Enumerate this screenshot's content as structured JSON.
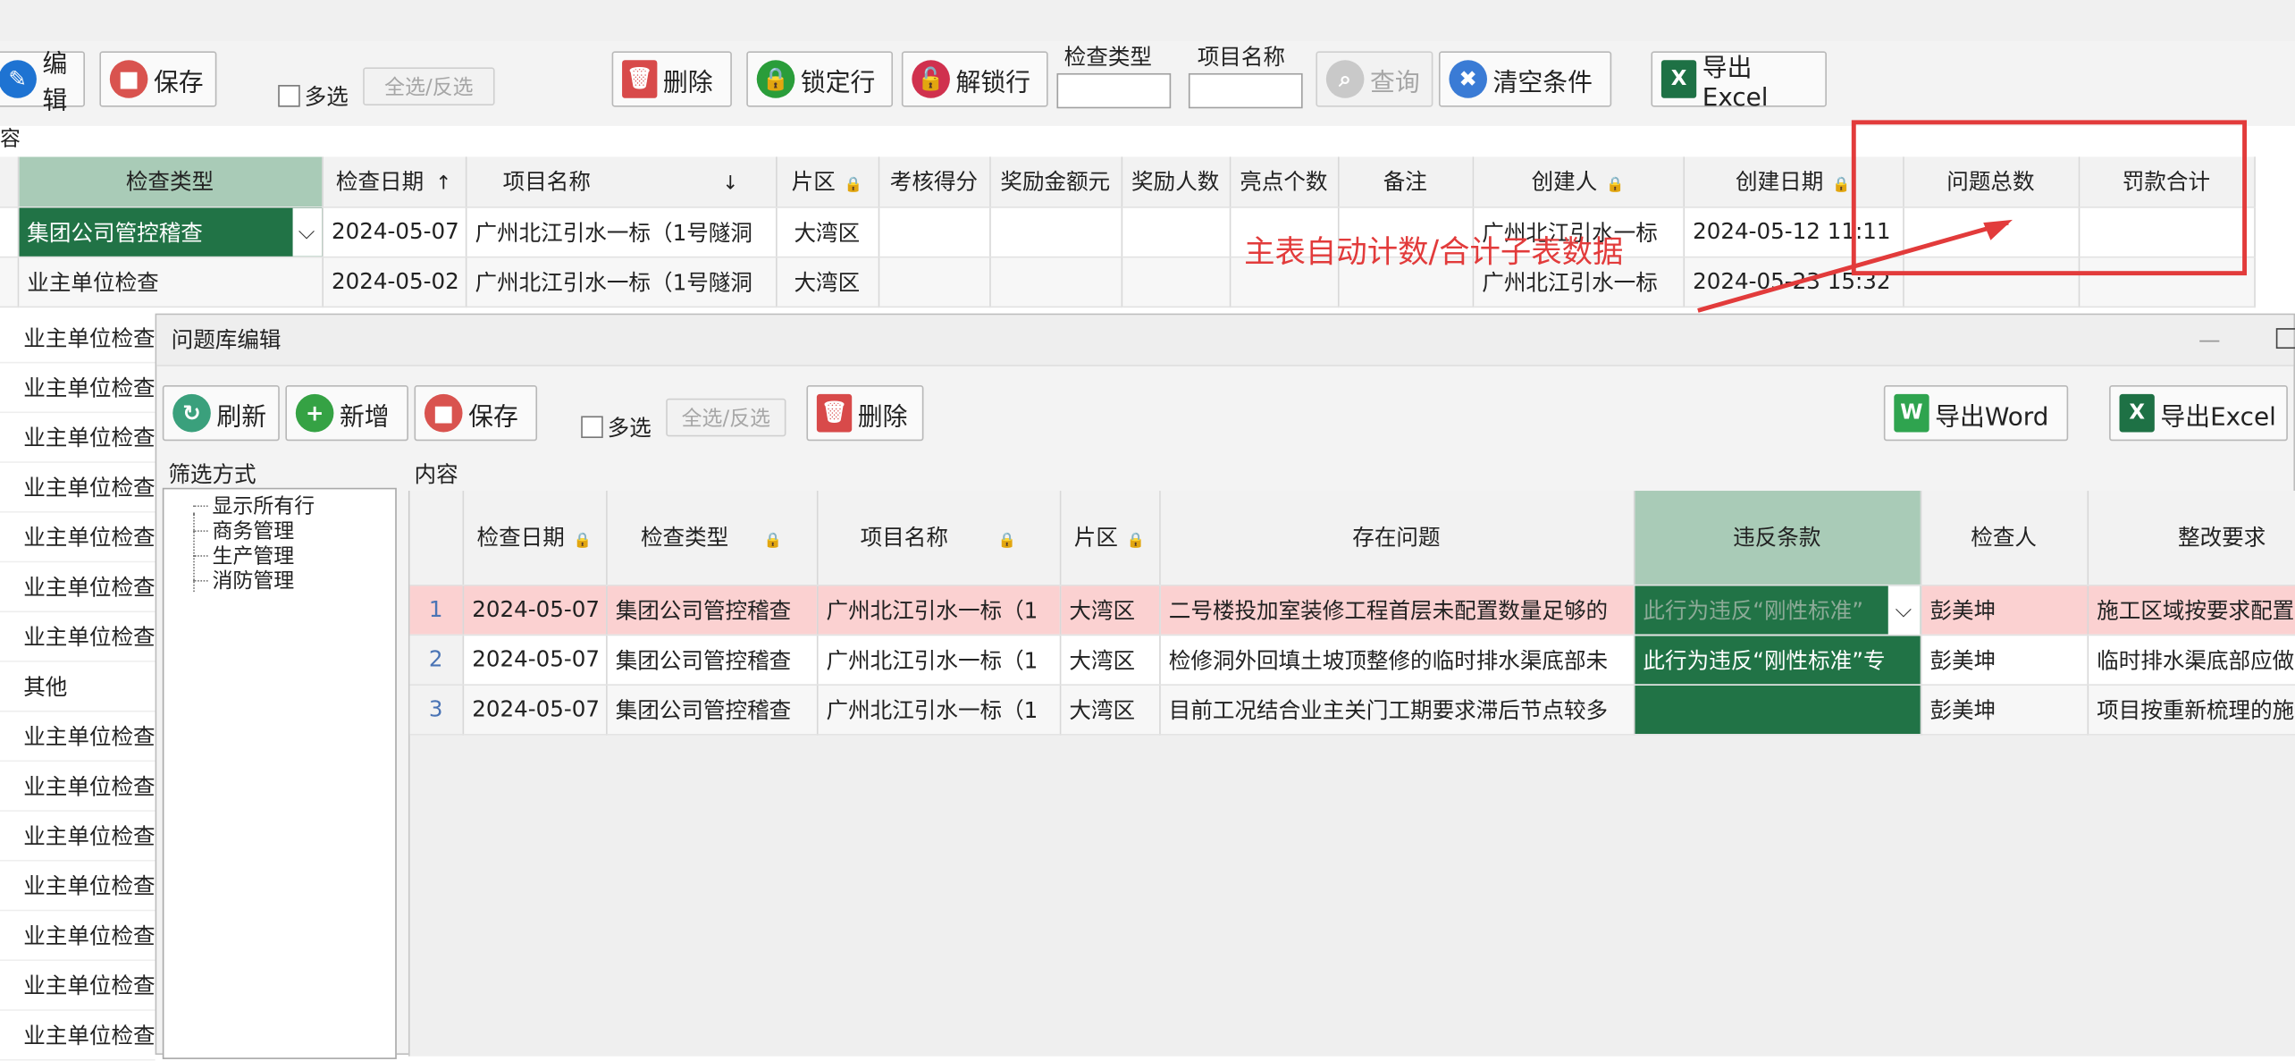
{
  "main_toolbar": {
    "edit": "编辑",
    "save": "保存",
    "multi_select": "多选",
    "select_all": "全选/反选",
    "delete": "删除",
    "lock_row": "锁定行",
    "unlock_row": "解锁行",
    "filter_type_label": "检查类型",
    "filter_project_label": "项目名称",
    "query": "查询",
    "clear": "清空条件",
    "export_excel": "导出Excel",
    "side_label": "容"
  },
  "main_grid": {
    "columns": [
      "检查类型",
      "检查日期",
      "项目名称",
      "片区",
      "考核得分",
      "奖励金额元",
      "奖励人数",
      "亮点个数",
      "备注",
      "创建人",
      "创建日期",
      "问题总数",
      "罚款合计"
    ],
    "rows": [
      {
        "type": "集团公司管控稽查",
        "date": "2024-05-07",
        "project": "广州北江引水一标（1号隧洞",
        "area": "大湾区",
        "creator": "广州北江引水一标",
        "created": "2024-05-12 11:11"
      },
      {
        "type": "业主单位检查",
        "date": "2024-05-02",
        "project": "广州北江引水一标（1号隧洞",
        "area": "大湾区",
        "creator": "广州北江引水一标",
        "created": "2024-05-23 15:32"
      }
    ],
    "left_column": [
      "业主单位检查",
      "业主单位检查",
      "业主单位检查",
      "业主单位检查",
      "业主单位检查",
      "业主单位检查",
      "业主单位检查",
      "其他",
      "业主单位检查",
      "业主单位检查",
      "业主单位检查",
      "业主单位检查",
      "业主单位检查",
      "业主单位检查",
      "业主单位检查"
    ]
  },
  "annotation": {
    "text": "主表自动计数/合计子表数据",
    "color": "#e23b3b"
  },
  "dialog": {
    "title": "问题库编辑",
    "refresh": "刷新",
    "add": "新增",
    "save": "保存",
    "multi_select": "多选",
    "select_all": "全选/反选",
    "delete": "删除",
    "export_word": "导出Word",
    "export_excel": "导出Excel",
    "filter_label": "筛选方式",
    "content_label": "内容",
    "tree": [
      "显示所有行",
      "商务管理",
      "生产管理",
      "消防管理"
    ],
    "columns": [
      "检查日期",
      "检查类型",
      "项目名称",
      "片区",
      "存在问题",
      "违反条款",
      "检查人",
      "整改要求"
    ],
    "rows": [
      {
        "n": "1",
        "date": "2024-05-07",
        "type": "集团公司管控稽查",
        "project": "广州北江引水一标（1",
        "area": "大湾区",
        "issue": "二号楼投加室装修工程首层未配置数量足够的",
        "clause": "此行为违反“刚性标准”",
        "inspector": "彭美坤",
        "req": "施工区域按要求配置数"
      },
      {
        "n": "2",
        "date": "2024-05-07",
        "type": "集团公司管控稽查",
        "project": "广州北江引水一标（1",
        "area": "大湾区",
        "issue": "检修洞外回填土坡顶整修的临时排水渠底部未",
        "clause": "此行为违反“刚性标准”专",
        "inspector": "彭美坤",
        "req": "临时排水渠底部应做好"
      },
      {
        "n": "3",
        "date": "2024-05-07",
        "type": "集团公司管控稽查",
        "project": "广州北江引水一标（1",
        "area": "大湾区",
        "issue": "目前工况结合业主关门工期要求滞后节点较多",
        "clause": "",
        "inspector": "彭美坤",
        "req": "项目按重新梳理的施工"
      }
    ]
  },
  "colors": {
    "selected_green": "#217346",
    "header_green": "#a9cbb7",
    "pink_row": "#fbd1d1"
  }
}
